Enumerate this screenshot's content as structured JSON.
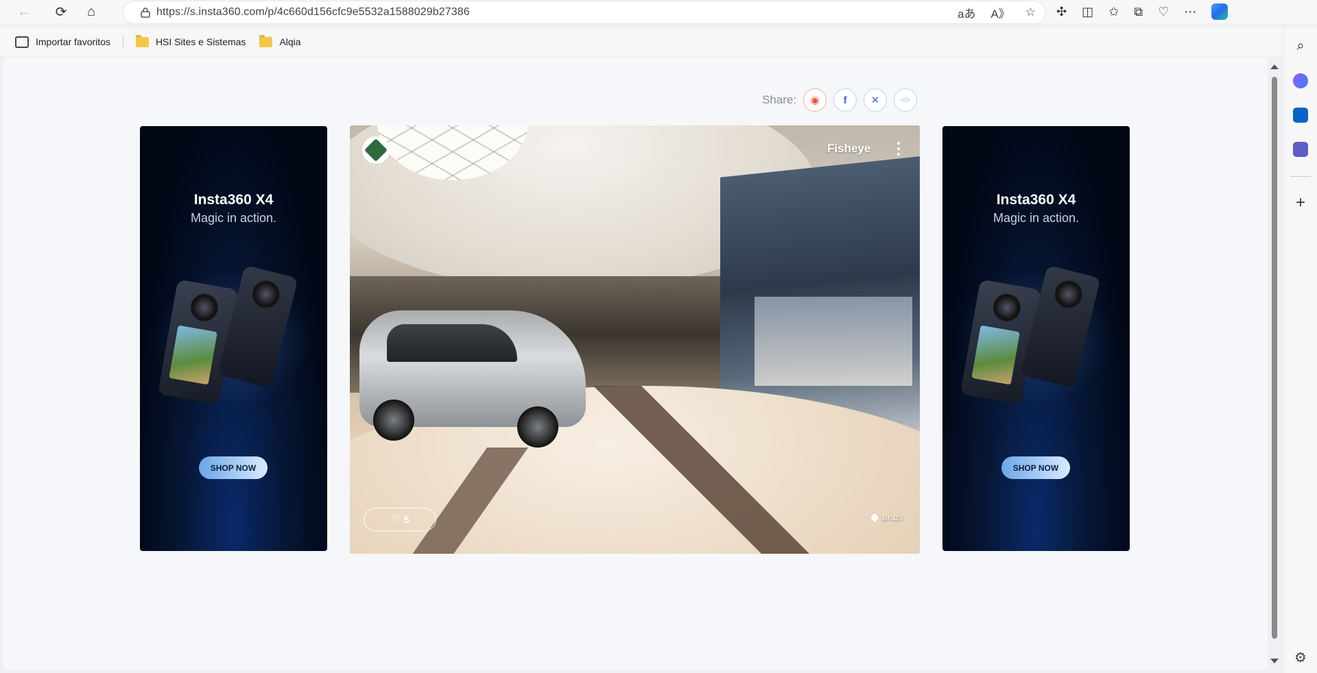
{
  "browser": {
    "url": "https://s.insta360.com/p/4c660d156cfc9e5532a1588029b27386",
    "favorites": [
      {
        "label": "Importar favoritos"
      },
      {
        "label": "HSI Sites e Sistemas"
      },
      {
        "label": "Alqia"
      }
    ]
  },
  "share": {
    "label": "Share:"
  },
  "ads": [
    {
      "title": "Insta360 X4",
      "subtitle": "Magic in action.",
      "cta": "SHOP NOW"
    },
    {
      "title": "Insta360 X4",
      "subtitle": "Magic in action.",
      "cta": "SHOP NOW"
    }
  ],
  "viewer": {
    "mode": "Fisheye",
    "likes": "5",
    "location": "Brazil"
  },
  "colors": {
    "accent": "#3a6fd8",
    "weibo": "#e6512d",
    "ad_bg": "#020716"
  }
}
